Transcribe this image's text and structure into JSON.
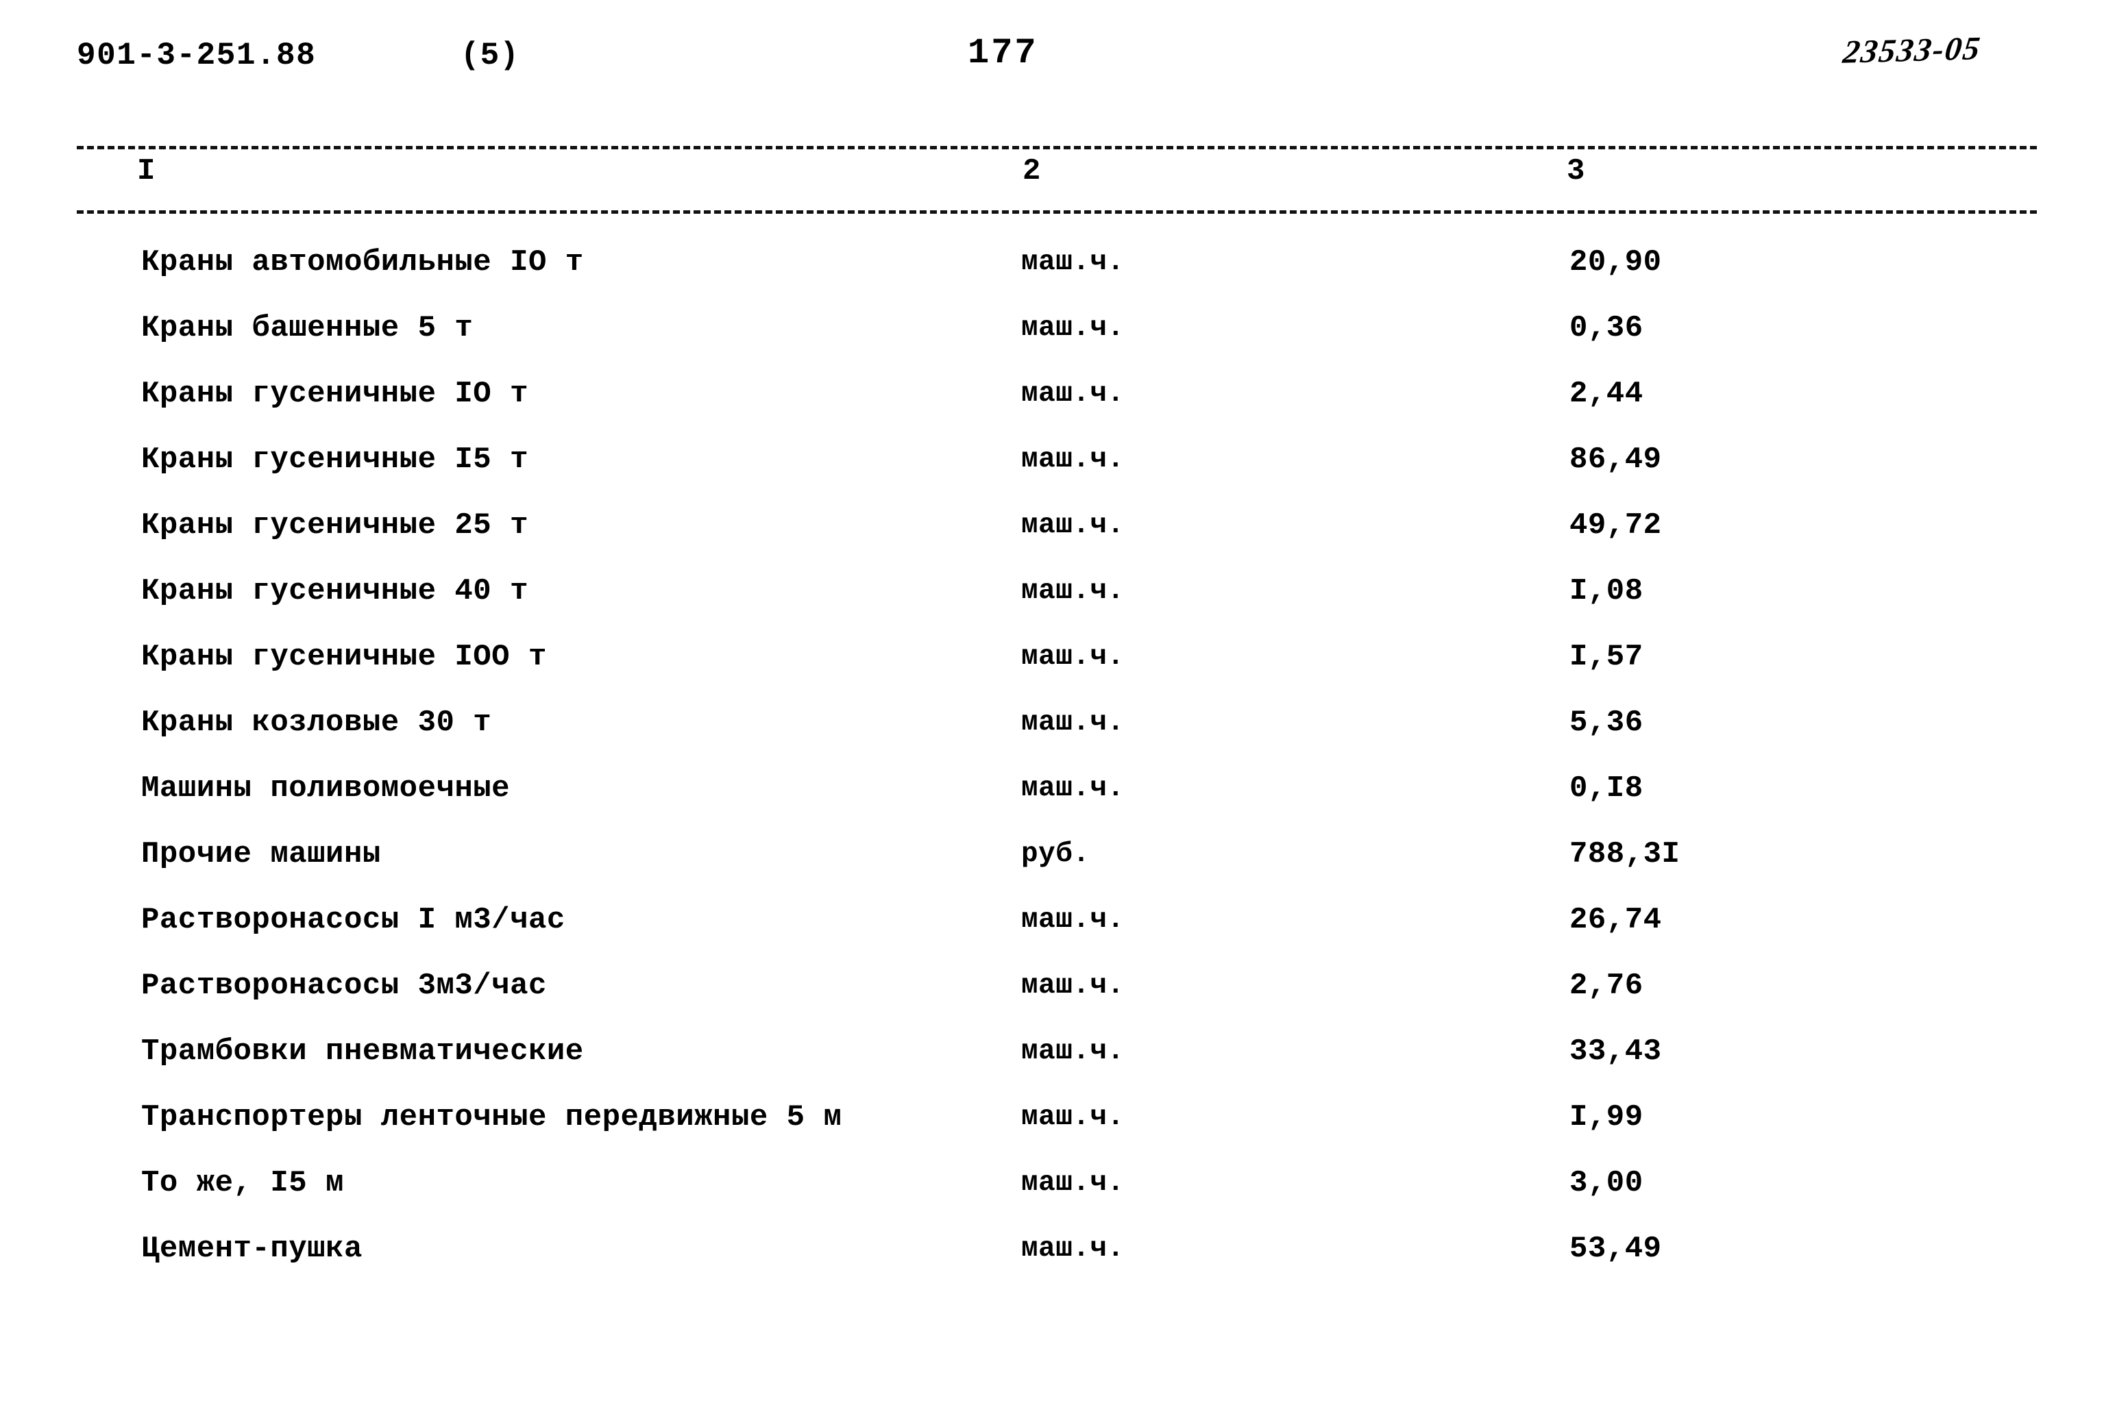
{
  "header": {
    "doc_code": "901-3-251.88",
    "sheet_no": "(5)",
    "page_no": "177",
    "archive_code": "23533-05"
  },
  "column_numbers": {
    "col1": "I",
    "col2": "2",
    "col3": "3"
  },
  "table": {
    "rows": [
      {
        "name": "Краны автомобильные IO т",
        "unit": "маш.ч.",
        "value": "20,90"
      },
      {
        "name": "Краны башенные 5 т",
        "unit": "маш.ч.",
        "value": "0,36"
      },
      {
        "name": "Краны гусеничные IO т",
        "unit": "маш.ч.",
        "value": "2,44"
      },
      {
        "name": "Краны гусеничные I5 т",
        "unit": "маш.ч.",
        "value": "86,49"
      },
      {
        "name": "Краны гусеничные 25 т",
        "unit": "маш.ч.",
        "value": "49,72"
      },
      {
        "name": "Краны гусеничные 40 т",
        "unit": "маш.ч.",
        "value": "I,08"
      },
      {
        "name": "Краны гусеничные IOO т",
        "unit": "маш.ч.",
        "value": "I,57"
      },
      {
        "name": "Краны козловые 30 т",
        "unit": "маш.ч.",
        "value": "5,36"
      },
      {
        "name": "Машины поливомоечные",
        "unit": "маш.ч.",
        "value": "0,I8"
      },
      {
        "name": "Прочие машины",
        "unit": "руб.",
        "value": "788,3I"
      },
      {
        "name": "Растворонасосы I м3/час",
        "unit": "маш.ч.",
        "value": "26,74"
      },
      {
        "name": "Растворонасосы 3м3/час",
        "unit": "маш.ч.",
        "value": "2,76"
      },
      {
        "name": "Трамбовки пневматические",
        "unit": "маш.ч.",
        "value": "33,43"
      },
      {
        "name": "Транспортеры ленточные передвижные 5 м",
        "unit": "маш.ч.",
        "value": "I,99"
      },
      {
        "name": "То же, I5 м",
        "unit": "маш.ч.",
        "value": "3,00"
      },
      {
        "name": "Цемент-пушка",
        "unit": "маш.ч.",
        "value": "53,49"
      }
    ]
  }
}
